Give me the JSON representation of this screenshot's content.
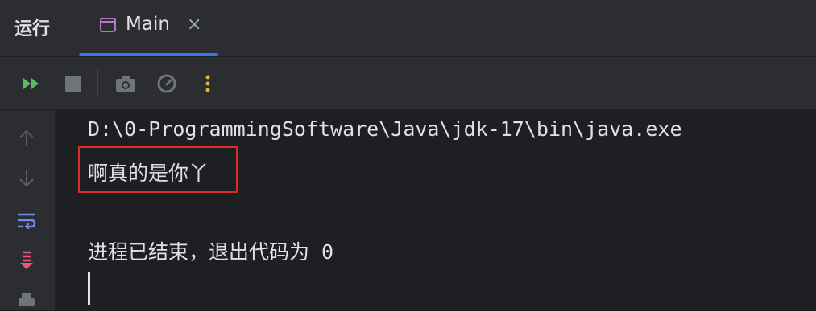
{
  "panel": {
    "title": "运行"
  },
  "tab": {
    "label": "Main",
    "close": "×"
  },
  "console": {
    "lines": [
      "D:\\0-ProgrammingSoftware\\Java\\jdk-17\\bin\\java.exe",
      "啊真的是你丫",
      "",
      "进程已结束，退出代码为 0"
    ]
  },
  "colors": {
    "accent": "#3574f0",
    "highlight": "#d92b2b",
    "run": "#5fb865",
    "icon_purple": "#b378c4"
  },
  "toolbar": {
    "icons": [
      "rerun-icon",
      "stop-icon",
      "camera-icon",
      "gauge-icon",
      "more-icon"
    ]
  },
  "gutter": {
    "icons": [
      "arrow-up-icon",
      "arrow-down-icon",
      "soft-wrap-icon",
      "scroll-to-end-icon",
      "print-icon"
    ]
  }
}
